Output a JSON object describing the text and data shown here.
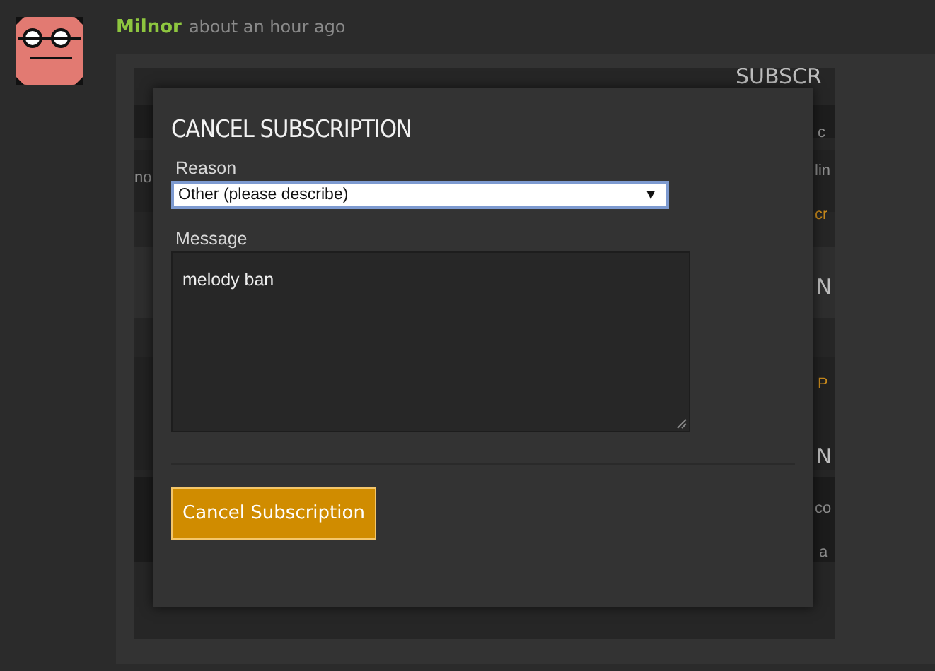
{
  "post": {
    "author": "Milnor",
    "time": "about an hour ago"
  },
  "background": [
    {
      "text": "SUBSCR",
      "kind": "heading"
    },
    {
      "text": "no",
      "kind": "text"
    },
    {
      "text": "c",
      "kind": "text"
    },
    {
      "text": "lin",
      "kind": "text"
    },
    {
      "text": "cr",
      "kind": "link"
    },
    {
      "text": "N",
      "kind": "heading"
    },
    {
      "text": "P",
      "kind": "link"
    },
    {
      "text": "N",
      "kind": "heading"
    },
    {
      "text": "co",
      "kind": "text"
    },
    {
      "text": "a",
      "kind": "text"
    }
  ],
  "modal": {
    "title": "CANCEL SUBSCRIPTION",
    "reason_label": "Reason",
    "reason_value": "Other (please describe)",
    "reason_arrow": "▼",
    "message_label": "Message",
    "message_value": "melody ban",
    "button": "Cancel Subscription"
  }
}
